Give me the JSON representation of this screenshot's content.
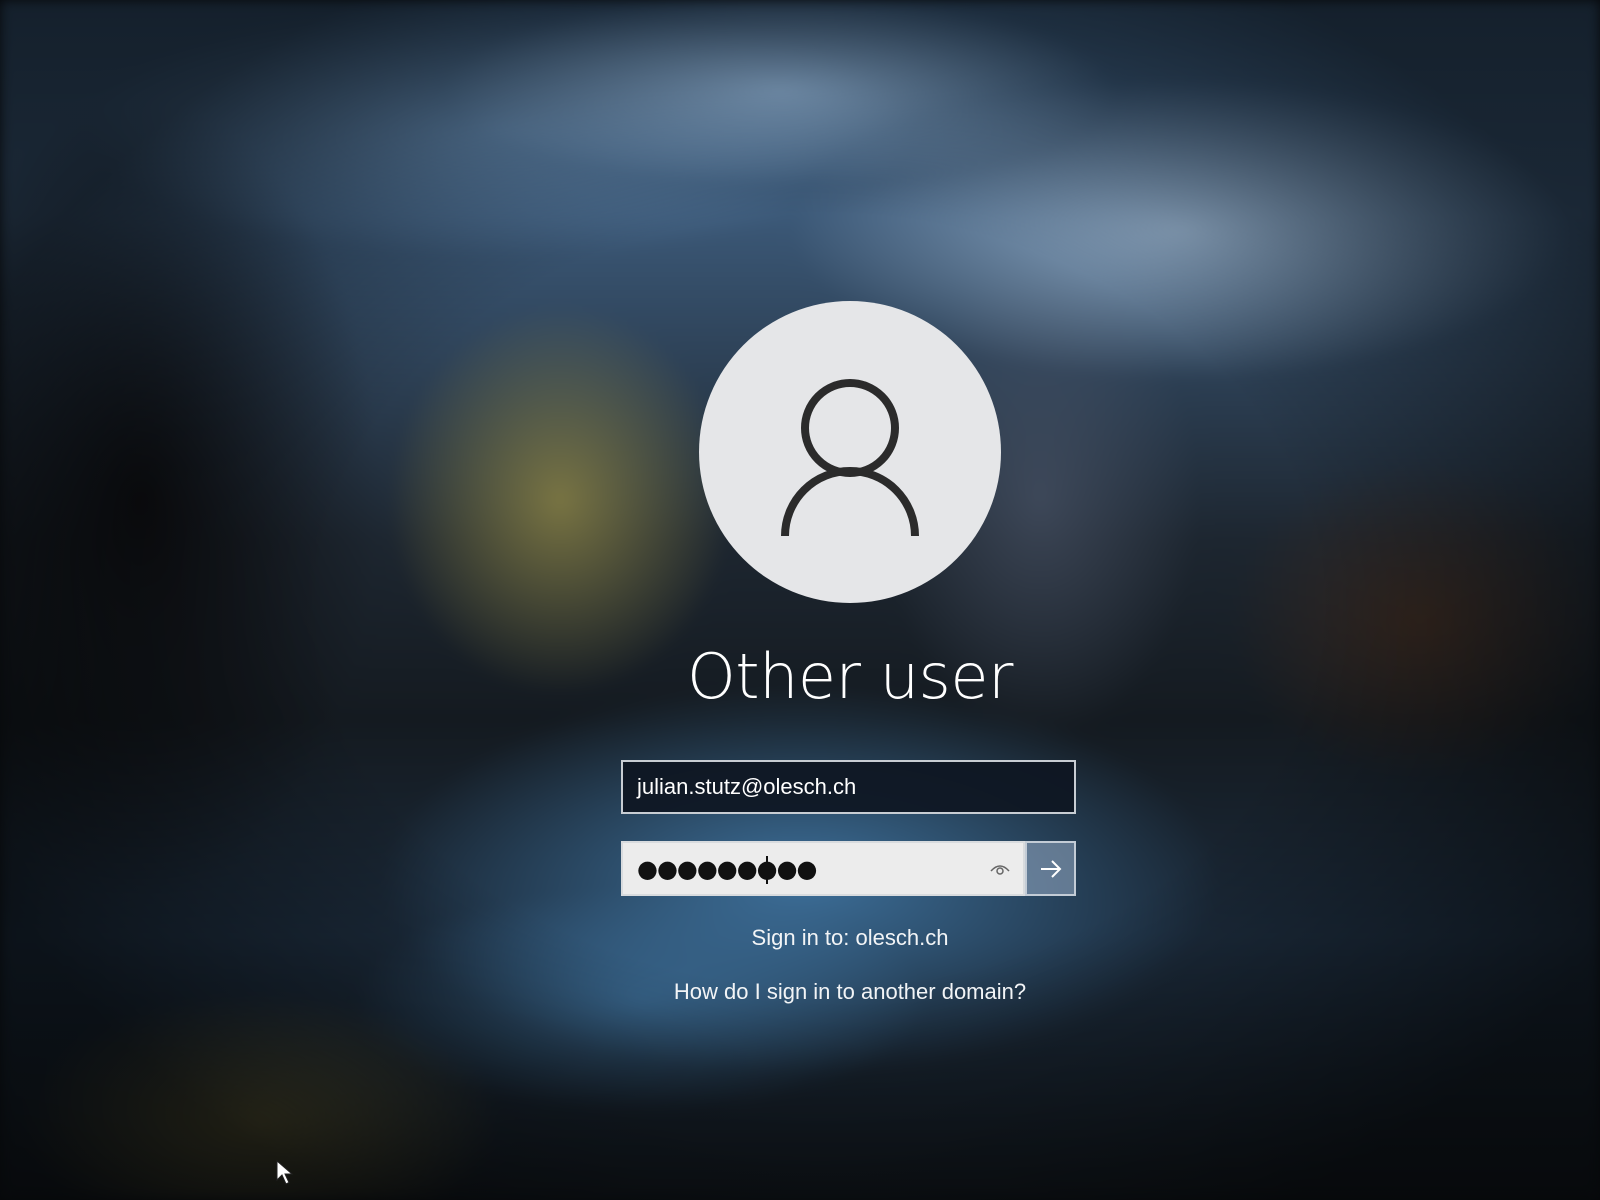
{
  "login": {
    "avatar_icon": "user-silhouette-icon",
    "user_name": "Other user",
    "email_value": "julian.stutz@olesch.ch",
    "password_mask": "●●●●●●●●●",
    "reveal_icon": "eye-icon",
    "submit_icon": "arrow-right-icon",
    "sign_in_to": "Sign in to: olesch.ch",
    "domain_help_link": "How do I sign in to another domain?"
  },
  "colors": {
    "text": "#ffffff",
    "avatar_bg": "#e5e6e8",
    "avatar_glyph": "#2b2b2b",
    "password_field_bg": "#ececec",
    "email_field_bg": "#0e1622"
  }
}
